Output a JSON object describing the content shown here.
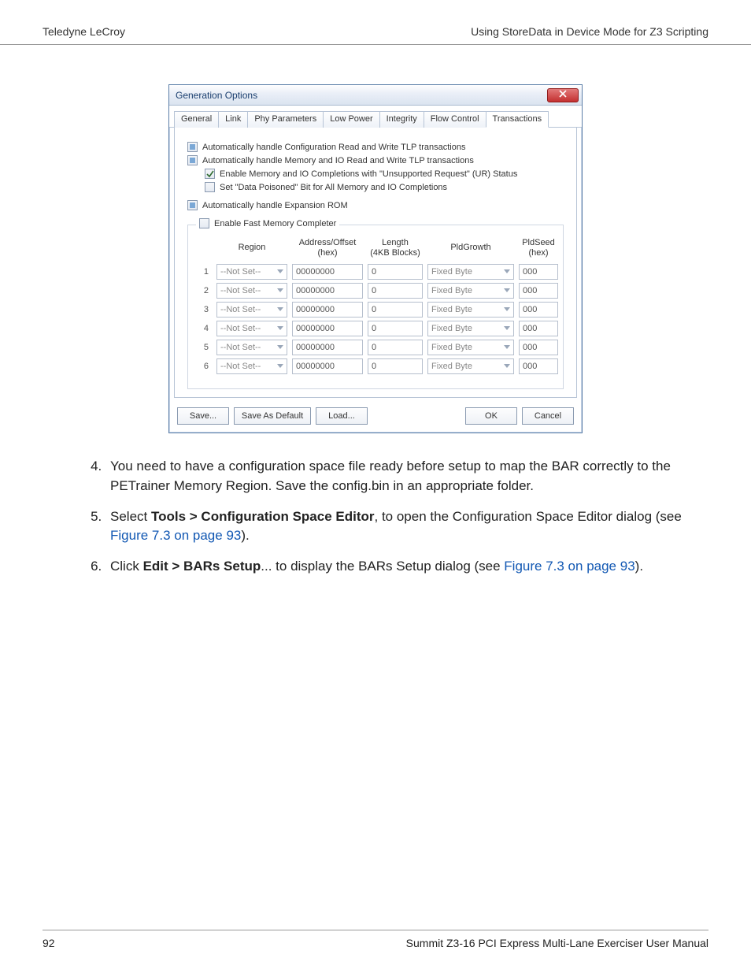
{
  "header": {
    "left": "Teledyne LeCroy",
    "right": "Using StoreData in Device Mode for Z3 Scripting"
  },
  "dialog": {
    "title": "Generation Options",
    "tabs": [
      "General",
      "Link",
      "Phy Parameters",
      "Low Power",
      "Integrity",
      "Flow Control",
      "Transactions"
    ],
    "active_tab": "Transactions",
    "checkboxes": {
      "cfg_rw": "Automatically handle Configuration Read and Write TLP transactions",
      "mem_io_rw": "Automatically handle Memory and IO Read and Write TLP transactions",
      "enable_ur": "Enable Memory and IO Completions with \"Unsupported Request\" (UR) Status",
      "data_poisoned": "Set \"Data Poisoned\" Bit for All Memory and IO Completions",
      "exp_rom": "Automatically handle Expansion ROM",
      "enable_fmc": "Enable Fast Memory Completer"
    },
    "grid": {
      "headers": {
        "region": "Region",
        "addr": "Address/Offset\n(hex)",
        "length": "Length\n(4KB Blocks)",
        "pldgrowth": "PldGrowth",
        "pldseed": "PldSeed\n(hex)"
      },
      "rows": [
        {
          "n": "1",
          "region": "--Not Set--",
          "addr": "00000000",
          "len": "0",
          "growth": "Fixed Byte",
          "seed": "000"
        },
        {
          "n": "2",
          "region": "--Not Set--",
          "addr": "00000000",
          "len": "0",
          "growth": "Fixed Byte",
          "seed": "000"
        },
        {
          "n": "3",
          "region": "--Not Set--",
          "addr": "00000000",
          "len": "0",
          "growth": "Fixed Byte",
          "seed": "000"
        },
        {
          "n": "4",
          "region": "--Not Set--",
          "addr": "00000000",
          "len": "0",
          "growth": "Fixed Byte",
          "seed": "000"
        },
        {
          "n": "5",
          "region": "--Not Set--",
          "addr": "00000000",
          "len": "0",
          "growth": "Fixed Byte",
          "seed": "000"
        },
        {
          "n": "6",
          "region": "--Not Set--",
          "addr": "00000000",
          "len": "0",
          "growth": "Fixed Byte",
          "seed": "000"
        }
      ]
    },
    "buttons": {
      "save": "Save...",
      "save_default": "Save As Default",
      "load": "Load...",
      "ok": "OK",
      "cancel": "Cancel"
    }
  },
  "steps": {
    "s4": "You need to have a configuration space file ready before setup to map the BAR correctly to the PETrainer Memory Region. Save the config.bin in an appropriate folder.",
    "s5_pre": "Select ",
    "s5_bold": "Tools > Configuration Space Editor",
    "s5_mid": ", to open the Configuration Space Editor dialog (see ",
    "s5_link": "Figure 7.3 on page 93",
    "s5_post": ").",
    "s6_pre": "Click ",
    "s6_bold": "Edit > BARs Setup",
    "s6_mid": "... to display the BARs Setup dialog (see ",
    "s6_link": "Figure 7.3 on page 93",
    "s6_post": ")."
  },
  "footer": {
    "page": "92",
    "title": "Summit Z3-16 PCI Express Multi-Lane Exerciser User Manual"
  }
}
